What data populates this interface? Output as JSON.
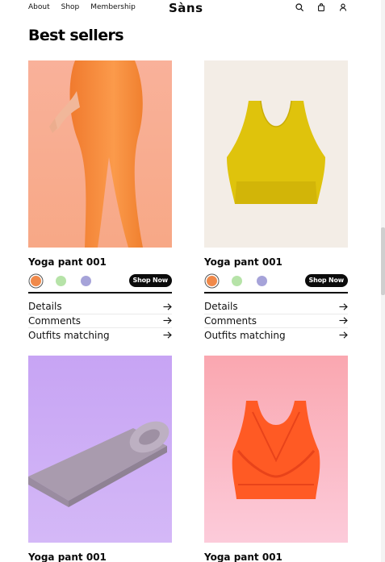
{
  "nav": {
    "links": [
      "About",
      "Shop",
      "Membership"
    ],
    "logo": "Sàns",
    "icons": [
      "search-icon",
      "bag-icon",
      "user-icon"
    ]
  },
  "section": {
    "title": "Best sellers"
  },
  "products": [
    {
      "name": "Yoga pant 001",
      "image": "orange-leggings",
      "swatches": [
        "#f0894a",
        "#b6e3a8",
        "#a6a3d9"
      ],
      "selected_swatch": 0,
      "shop_label": "Shop Now",
      "links": [
        "Details",
        "Comments",
        "Outfits matching"
      ]
    },
    {
      "name": "Yoga pant 001",
      "image": "yellow-sports-bra",
      "swatches": [
        "#f0894a",
        "#b6e3a8",
        "#a6a3d9"
      ],
      "selected_swatch": 0,
      "shop_label": "Shop Now",
      "links": [
        "Details",
        "Comments",
        "Outfits matching"
      ]
    },
    {
      "name": "Yoga pant 001",
      "image": "purple-yoga-mat"
    },
    {
      "name": "Yoga pant 001",
      "image": "orange-sports-bra"
    }
  ],
  "colors": {
    "accent_dark": "#0b0b0b",
    "img1_bg": "#f8b39a",
    "img2_bg": "#f3ede6",
    "img3_bg": "#cfaff6",
    "img4_bg": "#f9c2c8"
  }
}
